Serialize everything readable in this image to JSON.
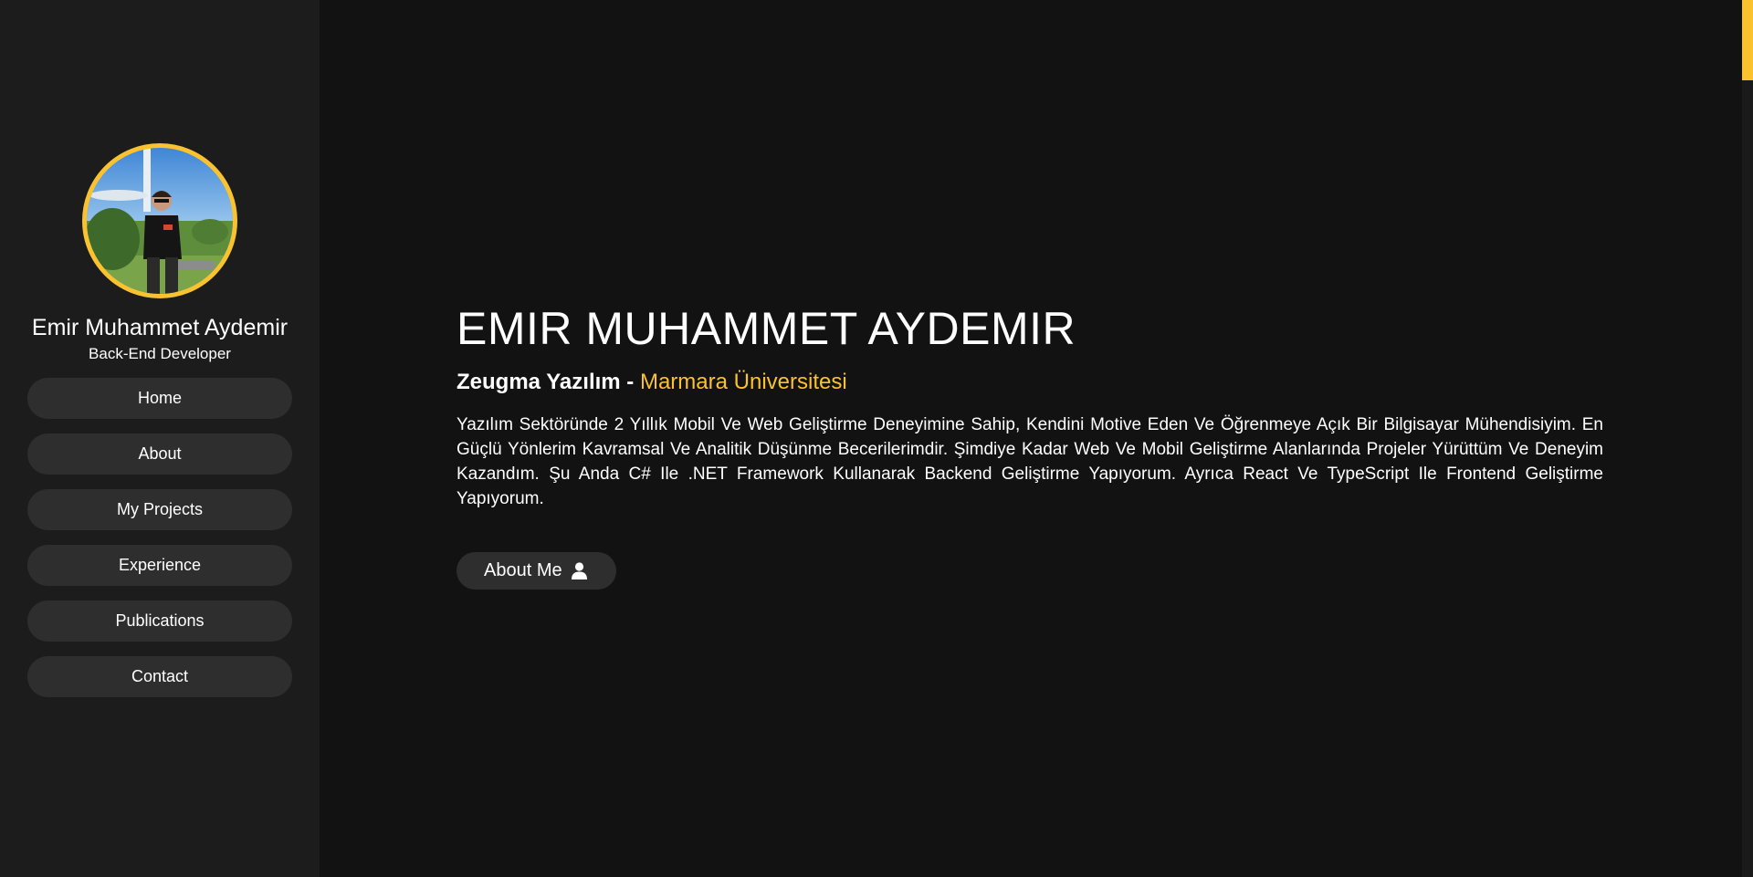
{
  "profile": {
    "name": "Emir Muhammet Aydemir",
    "role": "Back-End Developer",
    "avatar_icon": "profile-photo"
  },
  "nav": {
    "items": [
      {
        "label": "Home"
      },
      {
        "label": "About"
      },
      {
        "label": "My Projects"
      },
      {
        "label": "Experience"
      },
      {
        "label": "Publications"
      },
      {
        "label": "Contact"
      }
    ]
  },
  "hero": {
    "title": "EMIR MUHAMMET AYDEMIR",
    "company": "Zeugma Yazılım",
    "separator": "-",
    "university": "Marmara Üniversitesi",
    "description": "Yazılım Sektöründe 2 Yıllık Mobil Ve Web Geliştirme Deneyimine Sahip, Kendini Motive Eden Ve Öğrenmeye Açık Bir Bilgisayar Mühendisiyim. En Güçlü Yönlerim Kavramsal Ve Analitik Düşünme Becerilerimdir. Şimdiye Kadar Web Ve Mobil Geliştirme Alanlarında Projeler Yürüttüm Ve Deneyim Kazandım. Şu Anda C# Ile .NET Framework Kullanarak Backend Geliştirme Yapıyorum. Ayrıca React Ve TypeScript Ile Frontend Geliştirme Yapıyorum.",
    "button_label": "About Me",
    "button_icon": "user-icon"
  },
  "colors": {
    "accent": "#f9c22e",
    "background": "#121212",
    "sidebar": "#1c1c1c",
    "button": "#2e2e2e"
  }
}
